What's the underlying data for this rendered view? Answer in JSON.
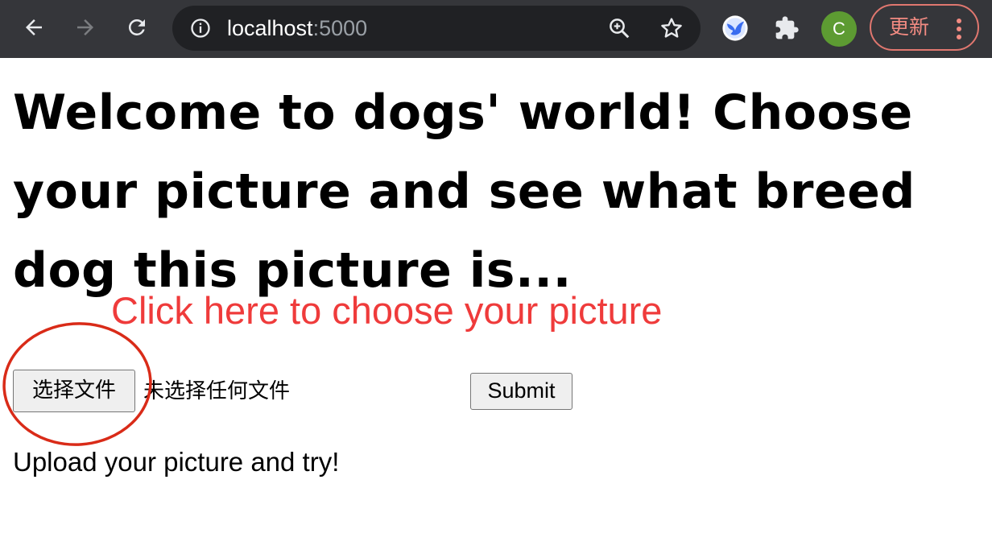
{
  "browser": {
    "url_host": "localhost",
    "url_port": ":5000",
    "profile_initial": "C",
    "update_label": "更新",
    "icons": {
      "back": "arrow-left-icon",
      "forward": "arrow-right-icon",
      "reload": "reload-icon",
      "site_info": "info-icon",
      "zoom": "zoom-in-icon",
      "bookmark": "star-icon",
      "extension_app": "bird-extension-icon",
      "extensions": "puzzle-icon",
      "menu": "kebab-menu-icon"
    },
    "colors": {
      "toolbar": "#35363a",
      "omnibox": "#202124",
      "avatar": "#5d9b32",
      "update_accent": "#f28b82"
    }
  },
  "page": {
    "heading": "Welcome to dogs' world! Choose your picture and see what breed dog this picture is...",
    "hint": "Click here to choose your picture",
    "file_button_label": "选择文件",
    "file_status": "未选择任何文件",
    "submit_label": "Submit",
    "caption": "Upload your picture and try!",
    "colors": {
      "hint": "#ef3b3b",
      "annotation_circle": "#d92b18"
    }
  }
}
